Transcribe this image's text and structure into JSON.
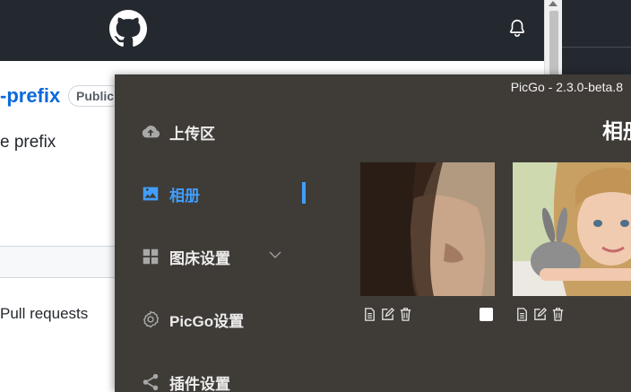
{
  "github": {
    "repo_name_fragment": "-prefix",
    "visibility_badge": "Public",
    "description_fragment": "e prefix",
    "pulls_tab": "Pull requests"
  },
  "picgo": {
    "version": "PicGo - 2.3.0-beta.8",
    "page_title": "相册",
    "nav": [
      {
        "label": "上传区",
        "icon": "cloud-upload-icon",
        "active": false
      },
      {
        "label": "相册",
        "icon": "image-icon",
        "active": true
      },
      {
        "label": "图床设置",
        "icon": "grid-icon",
        "active": false
      },
      {
        "label": "PicGo设置",
        "icon": "gear-icon",
        "active": false
      },
      {
        "label": "插件设置",
        "icon": "share-icon",
        "active": false
      }
    ],
    "gallery": [
      {
        "alt": "woman-closeup-photo",
        "actions": [
          "copy-icon",
          "edit-icon",
          "delete-icon"
        ],
        "selectable": true
      },
      {
        "alt": "girl-with-rabbit-photo",
        "actions": [
          "copy-icon",
          "edit-icon",
          "delete-icon"
        ],
        "selectable": false
      }
    ]
  },
  "colors": {
    "github_header": "#24292f",
    "picgo_bg": "#3f3b37",
    "accent": "#409eff"
  }
}
